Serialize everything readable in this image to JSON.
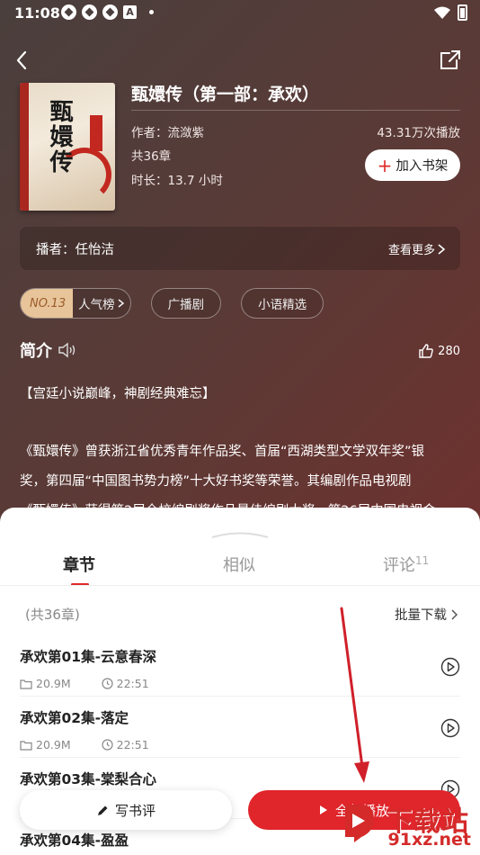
{
  "status_bar": {
    "time": "11:08"
  },
  "header": {
    "book_title": "甄嬛传（第一部：承欢）"
  },
  "book": {
    "author": "作者：流潋紫",
    "chapters": "共36章",
    "duration": "时长：13.7 小时",
    "plays": "43.31万次播放",
    "add_shelf_label": "加入书架"
  },
  "narrator": {
    "label": "播者：任怡洁",
    "more_label": "查看更多"
  },
  "tags": {
    "rank_no": "NO.13",
    "rank_name": "人气榜",
    "tag1": "广播剧",
    "tag2": "小语精选"
  },
  "intro": {
    "title": "简介",
    "likes": "280",
    "line1": "【宫廷小说巅峰，神剧经典难忘】",
    "line2": "《甄嬛传》曾获浙江省优秀青年作品奖、首届“西湖类型文学双年奖”银",
    "line3": "奖，第四届“中国图书势力榜”十大好书奖等荣誉。其编剧作品电视剧",
    "line4": "《甄嬛传》获得第2届全校编剧奖作品最佳编剧大奖，第26届中国电视金"
  },
  "tabs": {
    "chapters": "章节",
    "similar": "相似",
    "comments": "评论",
    "comments_count": "11"
  },
  "list": {
    "count": "(共36章)",
    "batch_download": "批量下载",
    "episodes": [
      {
        "name": "承欢第01集-云意春深",
        "size": "20.9M",
        "duration": "22:51"
      },
      {
        "name": "承欢第02集-落定",
        "size": "20.9M",
        "duration": "22:51"
      },
      {
        "name": "承欢第03集-棠梨合心",
        "size": "",
        "duration": ""
      },
      {
        "name": "承欢第04集-盈盈",
        "size": "",
        "duration": ""
      }
    ]
  },
  "bottom": {
    "write_review": "写书评",
    "play_all": "全部播放"
  },
  "cover": {
    "title_art": "甄嬛传"
  },
  "watermark": {
    "top": "下载站",
    "bottom": "91xz.net"
  },
  "colors": {
    "accent": "#e0252b",
    "rank_bg": "#e8c49a"
  }
}
